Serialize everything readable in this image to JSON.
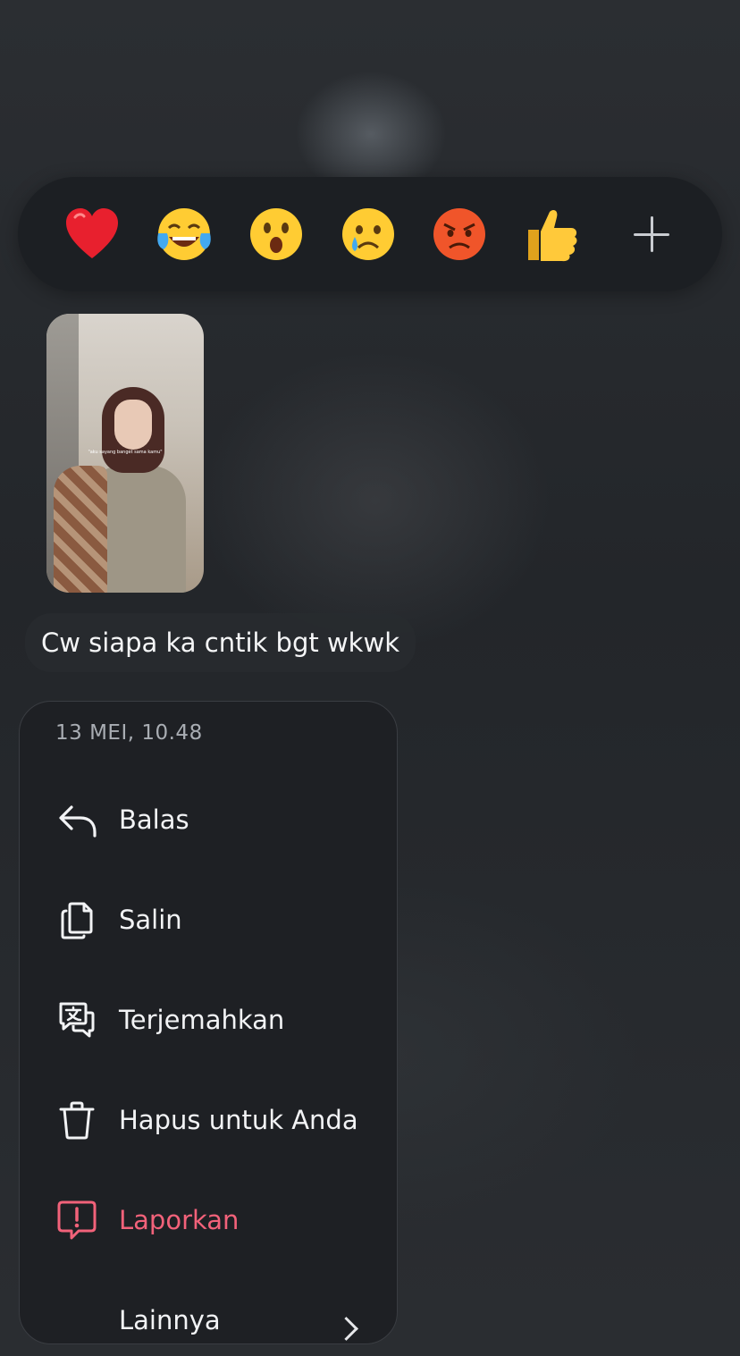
{
  "reactions": {
    "items": [
      {
        "name": "red-heart",
        "glyph": "❤️"
      },
      {
        "name": "tears-of-joy",
        "glyph": "😂"
      },
      {
        "name": "astonished",
        "glyph": "😮"
      },
      {
        "name": "crying",
        "glyph": "😢"
      },
      {
        "name": "angry",
        "glyph": "😡"
      },
      {
        "name": "thumbs-up",
        "glyph": "👍"
      }
    ],
    "more_icon": "plus-icon"
  },
  "media": {
    "caption": "\"aku sayang banget sama kamu\""
  },
  "message": {
    "text": "Cw siapa ka cntik bgt wkwk"
  },
  "menu": {
    "timestamp": "13 MEI, 10.48",
    "items": [
      {
        "label": "Balas",
        "icon": "reply-icon"
      },
      {
        "label": "Salin",
        "icon": "copy-icon"
      },
      {
        "label": "Terjemahkan",
        "icon": "translate-icon"
      },
      {
        "label": "Hapus untuk Anda",
        "icon": "trash-icon"
      },
      {
        "label": "Laporkan",
        "icon": "report-icon",
        "color": "#f2627a"
      },
      {
        "label": "Lainnya",
        "icon": "chevron-right-icon"
      }
    ]
  },
  "colors": {
    "danger": "#f2627a",
    "menu_bg": "#1e2024",
    "reaction_bar_bg": "#1c1f23"
  }
}
